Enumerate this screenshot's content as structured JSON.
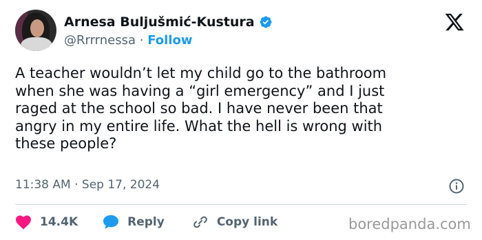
{
  "author": {
    "display_name": "Arnesa Buljušmić-Kustura",
    "handle": "@Rrrrnessa",
    "separator": " · ",
    "follow_label": "Follow",
    "verified_icon": "verified-badge-icon"
  },
  "tweet": {
    "text": "A teacher wouldn’t let my child go to the bathroom\nwhen she was having a “girl emergency” and I just\nraged at the school so bad. I have never been that\nangry in my entire life. What the hell is wrong with\nthese people?",
    "timestamp": "11:38 AM · Sep 17, 2024"
  },
  "actions": {
    "like_count": "14.4K",
    "reply_label": "Reply",
    "copy_link_label": "Copy link"
  },
  "watermark": "boredpanda.com",
  "colors": {
    "accent": "#1d9bf0",
    "like": "#f91880",
    "muted": "#536471"
  }
}
